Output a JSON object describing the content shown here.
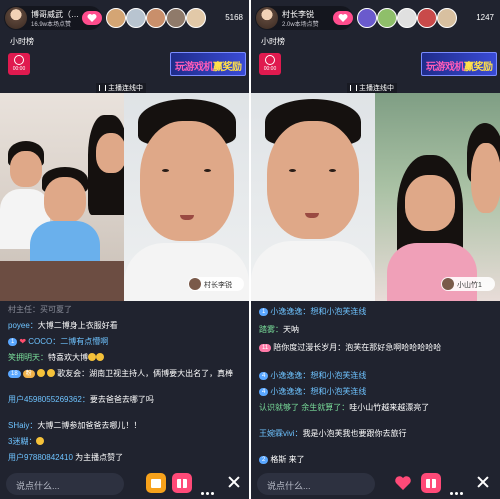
{
  "left": {
    "host": {
      "name": "博哥威武（…",
      "sub": "16.9w本场点赞"
    },
    "viewer_count": "5168",
    "rank_label": "小时榜",
    "badge_time": "00:00",
    "promo": {
      "part1": "玩游戏机",
      "part2": "赢奖励"
    },
    "link_label": "主播连线中",
    "guest_tag": "村长李锐",
    "chat": [
      {
        "user": "",
        "text": "村主任：买可夏了",
        "level": ""
      },
      {
        "user": "poyee：",
        "text": "大博二博身上衣服好看",
        "level": ""
      },
      {
        "user": "",
        "level": "1",
        "text": "COCO：二博有点懵啊"
      },
      {
        "user": "笑拥明天：",
        "text": "特喜欢大博",
        "level": ""
      },
      {
        "user": "",
        "level": "18",
        "text": "歌友会：湖南卫视主持人，俩博要大出名了，真棒"
      },
      {
        "user": "用户4598055269362：",
        "text": "要去爸爸去哪了吗",
        "level": ""
      },
      {
        "user": "SHaiy：",
        "text": "大博二博参加爸爸去哪儿！！",
        "level": ""
      },
      {
        "user": "3迷糊：",
        "text": "",
        "level": ""
      },
      {
        "user": "用户97880842410",
        "text": " 为主播点赞了",
        "level": ""
      }
    ],
    "input_placeholder": "说点什么..."
  },
  "right": {
    "host": {
      "name": "村长李锐",
      "sub": "2.0w本场点赞"
    },
    "viewer_count": "1247",
    "rank_label": "小时榜",
    "badge_time": "00:00",
    "promo": {
      "part1": "玩游戏机",
      "part2": "赢奖励"
    },
    "link_label": "主播连线中",
    "guest_tag": "小山竹1",
    "chat": [
      {
        "user": "",
        "level": "1",
        "text": "小逸逸逸：想和小泡芙连线"
      },
      {
        "user": "踏雾：",
        "text": "天呐",
        "level": ""
      },
      {
        "user": "",
        "level": "11",
        "text": "陪你度过漫长岁月：泡芙在那好急啊哈哈哈哈哈"
      },
      {
        "user": "",
        "level": "4",
        "text": "小逸逸逸：想和小泡芙连线"
      },
      {
        "user": "",
        "level": "4",
        "text": "小逸逸逸：想和小泡芙连线"
      },
      {
        "user": "认识就够了 余生就算了：",
        "text": "哇小山竹越来越漂亮了",
        "level": ""
      },
      {
        "user": "王婉霖vivi：",
        "text": "我是小泡芙我也要跟你去旅行",
        "level": ""
      },
      {
        "user": "",
        "level": "2",
        "text": "格斯 来了"
      }
    ],
    "input_placeholder": "说点什么..."
  }
}
